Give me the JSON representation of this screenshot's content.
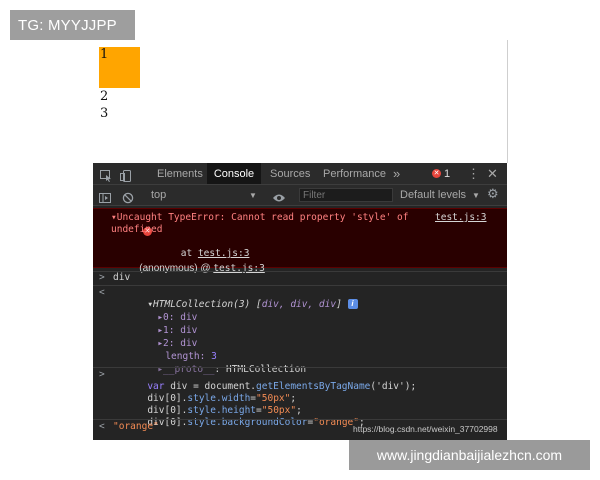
{
  "overlay": {
    "tag_label": "TG: MYYJJPP",
    "watermark": "www.jingdianbaijialezhcn.com"
  },
  "page": {
    "items": [
      "1",
      "2",
      "3"
    ],
    "box_color": "#ffa500"
  },
  "devtools": {
    "tabs": [
      "Elements",
      "Console",
      "Sources",
      "Performance"
    ],
    "active_tab": "Console",
    "more_tabs_label": "»",
    "error_count": "1",
    "context": "top",
    "filter_placeholder": "Filter",
    "levels_label": "Default levels",
    "error": {
      "line1": "▾Uncaught TypeError: Cannot read property 'style' of",
      "line2": "undefined",
      "at_prefix": "at ",
      "at_link": "test.js:3",
      "anon_prefix": "(anonymous) @ ",
      "anon_link": "test.js:3",
      "source_link": "test.js:3"
    },
    "input1": "div",
    "result": {
      "head": "▾HTMLCollection(3) [",
      "items_preview": "div, div, div",
      "tail": "]",
      "badge": "i",
      "entries": [
        {
          "key": "▸0: ",
          "value": "div"
        },
        {
          "key": "▸1: ",
          "value": "div"
        },
        {
          "key": "▸2: ",
          "value": "div"
        }
      ],
      "length_key": "length: ",
      "length_value": "3",
      "proto_key": "▸__proto__",
      "proto_value": ": HTMLCollection"
    },
    "input2": {
      "l1_kw": "var",
      "l1_rest": " div = document.",
      "l1_method": "getElementsByTagName",
      "l1_arg": "('div');",
      "l2_pre": "div[0].",
      "l2_prop": "style.width",
      "l2_eq": "=",
      "l2_val": "\"50px\"",
      "l2_end": ";",
      "l3_pre": "div[0].",
      "l3_prop": "style.height",
      "l3_eq": "=",
      "l3_val": "\"50px\"",
      "l3_end": ";",
      "l4_pre": "div[0].",
      "l4_prop": "style.backgroundColor",
      "l4_eq": "=",
      "l4_val": "\"orange\"",
      "l4_end": ";"
    },
    "output2": "\"orange\"",
    "prompt_in": ">",
    "prompt_out": "<",
    "csdn_credit": "https://blog.csdn.net/weixin_37702998"
  }
}
